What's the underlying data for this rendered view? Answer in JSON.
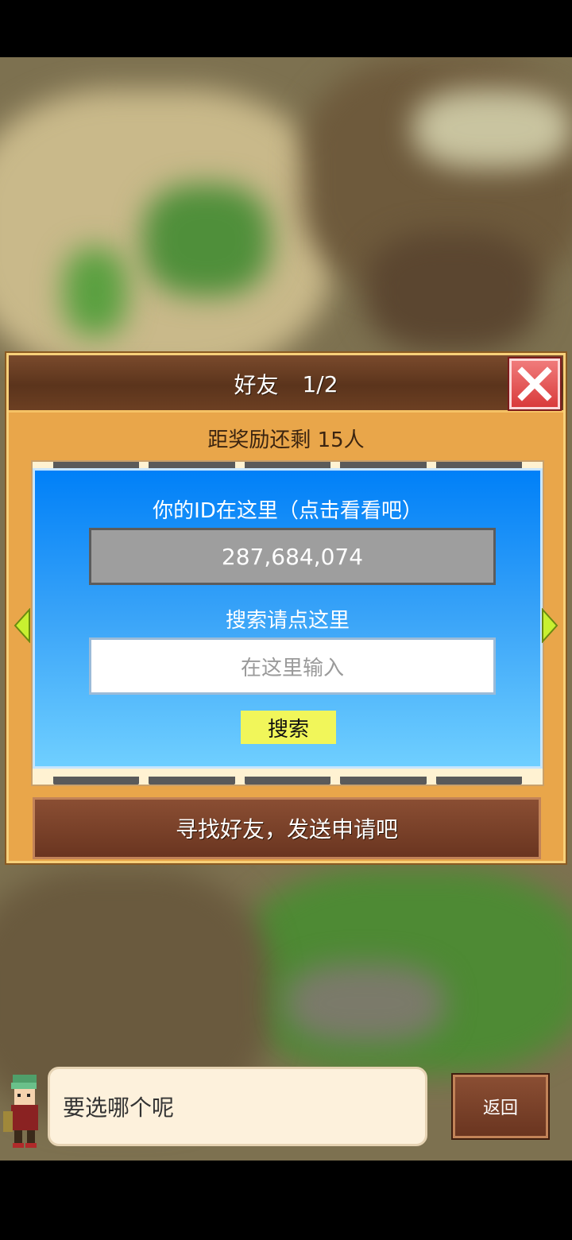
{
  "dialog": {
    "title": "好友",
    "page_indicator": "1/2",
    "reward_text": "距奖励还剩 15人",
    "close_icon": "close-x-icon"
  },
  "panel": {
    "id_label": "你的ID在这里（点击看看吧）",
    "id_value": "287,684,074",
    "search_label": "搜索请点这里",
    "search_placeholder": "在这里输入",
    "search_button_label": "搜索"
  },
  "find_friends_button_label": "寻找好友，发送申请吧",
  "bottom": {
    "message": "要选哪个呢",
    "back_button_label": "返回"
  },
  "colors": {
    "frame": "#e9a64a",
    "header": "#5b341c",
    "panel_top": "#0080f8",
    "panel_bottom": "#6fcfff",
    "close_button": "#d93b3b",
    "search_button": "#f1f65a",
    "arrow": "#c8f030"
  }
}
